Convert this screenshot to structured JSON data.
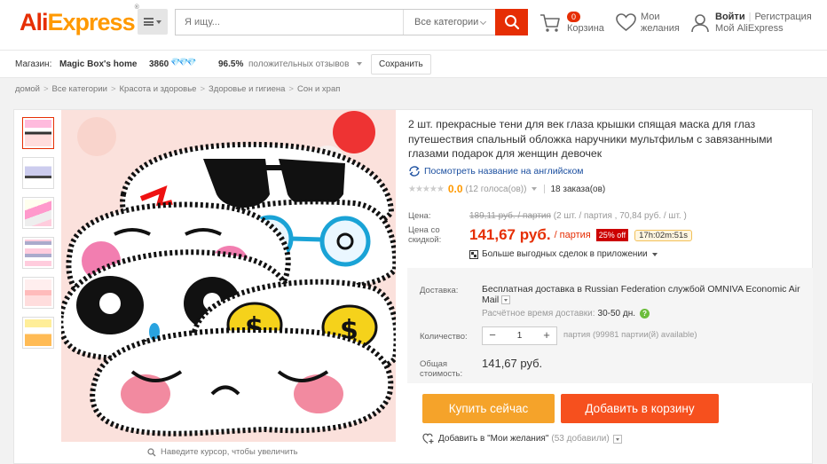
{
  "header": {
    "logo_ali": "Ali",
    "logo_express": "Express",
    "logo_mark": "®",
    "search_placeholder": "Я ищу...",
    "search_category": "Все категории",
    "cart_count": "0",
    "cart_label": "Корзина",
    "wishlist_line1": "Мои",
    "wishlist_line2": "желания",
    "signin_label": "Войти",
    "register_label": "Регистрация",
    "my_account_label": "Мой AliExpress"
  },
  "store": {
    "label": "Магазин:",
    "name": "Magic Box's home",
    "score": "3860",
    "diamonds": "💎💎💎",
    "positive_pct": "96.5%",
    "positive_label": "положительных отзывов",
    "save_label": "Сохранить"
  },
  "breadcrumb": [
    "домой",
    "Все категории",
    "Красота и здоровье",
    "Здоровье и гигиена",
    "Сон и храп"
  ],
  "product": {
    "title": "2 шт. прекрасные тени для век глаза крышки спящая маска для глаз путешествия спальный обложка наручники мультфильм с завязанными глазами подарок для женщин девочек",
    "translate_label": "Посмотреть название на английском",
    "rating_value": "0.0",
    "rating_votes": "(12 голоса(ов))",
    "orders": "18 заказа(ов)",
    "zoom_hint": "Наведите курсор, чтобы увеличить"
  },
  "pricing": {
    "price_label": "Цена:",
    "old_price": "189,11 руб. / партия",
    "old_price_note": "(2 шт. / партия , 70,84 руб. / шт. )",
    "discount_label_1": "Цена со",
    "discount_label_2": "скидкой:",
    "new_price": "141,67 руб.",
    "new_price_unit": "/ партия",
    "off_badge": "25% off",
    "timer": "17h:02m:51s",
    "app_deals": "Больше выгодных сделок в приложении"
  },
  "shipping": {
    "label": "Доставка:",
    "text": "Бесплатная доставка в Russian Federation службой OMNIVA Economic Air Mail",
    "delivery_time_label": "Расчётное время доставки:",
    "delivery_time_value": "30-50 дн.",
    "qty_label": "Количество:",
    "qty_value": "1",
    "qty_minus": "−",
    "qty_plus": "+",
    "availability": "партия (99981 партии(й) available)",
    "total_label_1": "Общая",
    "total_label_2": "стоимость:",
    "total_value": "141,67 руб."
  },
  "actions": {
    "buy_now": "Купить сейчас",
    "add_to_cart": "Добавить в корзину",
    "add_to_wishlist": "Добавить в \"Мои желания\"",
    "wishlist_count": "(53 добавили)"
  },
  "colors": {
    "brand_red": "#e62e04",
    "brand_orange": "#ff9900",
    "buy_button": "#f5a32a",
    "cart_button": "#f6501e"
  }
}
